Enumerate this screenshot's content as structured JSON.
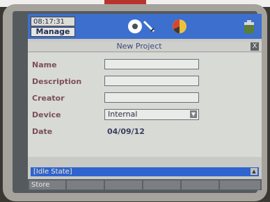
{
  "status": {
    "time": "08:17:31",
    "mode_button": "Manage",
    "icons": [
      "disk-icon",
      "probe-icon",
      "pie-chart-icon",
      "battery-icon"
    ],
    "colors": {
      "status_bar": "#3d6fce",
      "accent_yellow": "#e9c33b"
    }
  },
  "window": {
    "title": "New Project",
    "close_label": "X"
  },
  "form": {
    "name": {
      "label": "Name",
      "value": ""
    },
    "description": {
      "label": "Description",
      "value": ""
    },
    "creator": {
      "label": "Creator",
      "value": ""
    },
    "device": {
      "label": "Device",
      "value": "Internal"
    },
    "date": {
      "label": "Date",
      "value": "04/09/12"
    }
  },
  "message_bar": {
    "text": "[Idle State]"
  },
  "softkeys": [
    "Store",
    "",
    "",
    "",
    "",
    ""
  ]
}
